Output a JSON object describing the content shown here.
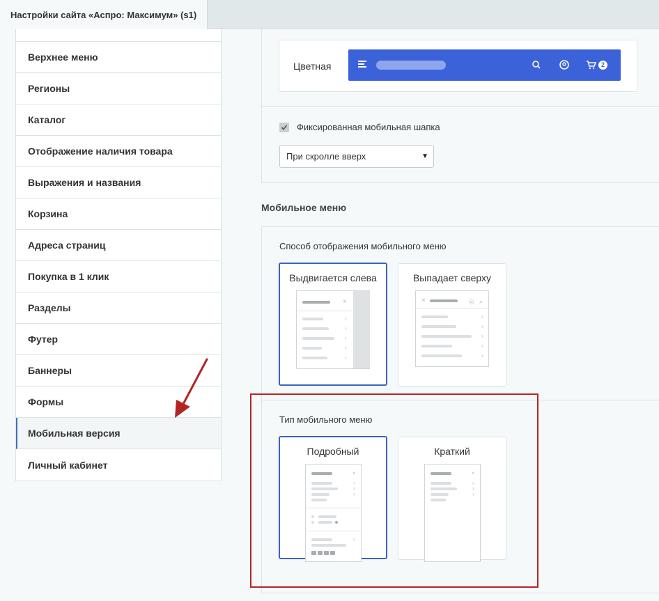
{
  "tab": {
    "title": "Настройки сайта «Аспро: Максимум» (s1)"
  },
  "sidebar": {
    "items": [
      {
        "label": "Верхнее меню"
      },
      {
        "label": "Регионы"
      },
      {
        "label": "Каталог"
      },
      {
        "label": "Отображение наличия товара"
      },
      {
        "label": "Выражения и названия"
      },
      {
        "label": "Корзина"
      },
      {
        "label": "Адреса страниц"
      },
      {
        "label": "Покупка в 1 клик"
      },
      {
        "label": "Разделы"
      },
      {
        "label": "Футер"
      },
      {
        "label": "Баннеры"
      },
      {
        "label": "Формы"
      },
      {
        "label": "Мобильная версия"
      },
      {
        "label": "Личный кабинет"
      }
    ],
    "active_item": "Мобильная версия"
  },
  "header_color": {
    "label": "Цветная",
    "cart_count": "2",
    "accent": "#3c62d9"
  },
  "fixed_header": {
    "checkbox_label": "Фиксированная мобильная шапка",
    "checked": true,
    "select_value": "При скролле вверх"
  },
  "mobile_menu": {
    "section_title": "Мобильное меню",
    "display_mode": {
      "label": "Способ отображения мобильного меню",
      "options": [
        {
          "title": "Выдвигается слева",
          "selected": true
        },
        {
          "title": "Выпадает сверху",
          "selected": false
        }
      ]
    },
    "menu_type": {
      "label": "Тип мобильного меню",
      "options": [
        {
          "title": "Подробный",
          "selected": true
        },
        {
          "title": "Краткий",
          "selected": false
        }
      ]
    }
  },
  "annotation": {
    "color": "#b32525"
  }
}
